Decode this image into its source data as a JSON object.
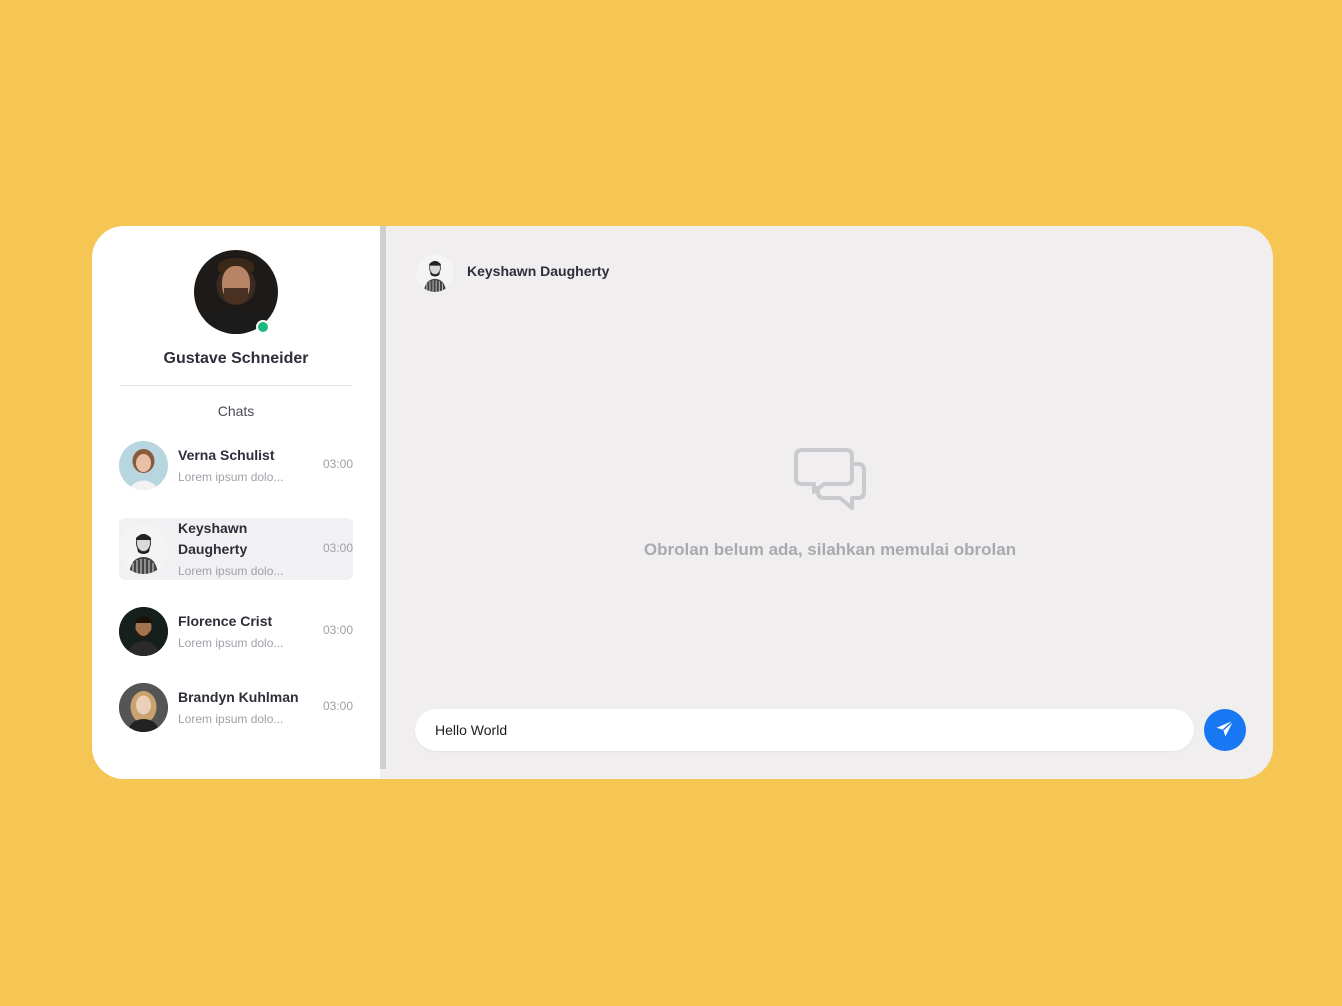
{
  "user": {
    "name": "Gustave Schneider",
    "status": "online"
  },
  "sidebar": {
    "title": "Chats",
    "chats": [
      {
        "name": "Verna Schulist",
        "preview": "Lorem ipsum dolo...",
        "time": "03:00",
        "active": false
      },
      {
        "name": "Keyshawn Daugherty",
        "preview": "Lorem ipsum dolo...",
        "time": "03:00",
        "active": true
      },
      {
        "name": "Florence Crist",
        "preview": "Lorem ipsum dolo...",
        "time": "03:00",
        "active": false
      },
      {
        "name": "Brandyn Kuhlman",
        "preview": "Lorem ipsum dolo...",
        "time": "03:00",
        "active": false
      }
    ]
  },
  "conversation": {
    "contact_name": "Keyshawn Daugherty",
    "empty_message": "Obrolan belum ada, silahkan memulai obrolan",
    "input_value": "Hello World"
  },
  "colors": {
    "background": "#F5C653",
    "accent": "#1877F2",
    "online": "#1DB97C"
  },
  "icons": {
    "empty_state": "chat-bubbles-icon",
    "send": "paper-plane-icon"
  }
}
